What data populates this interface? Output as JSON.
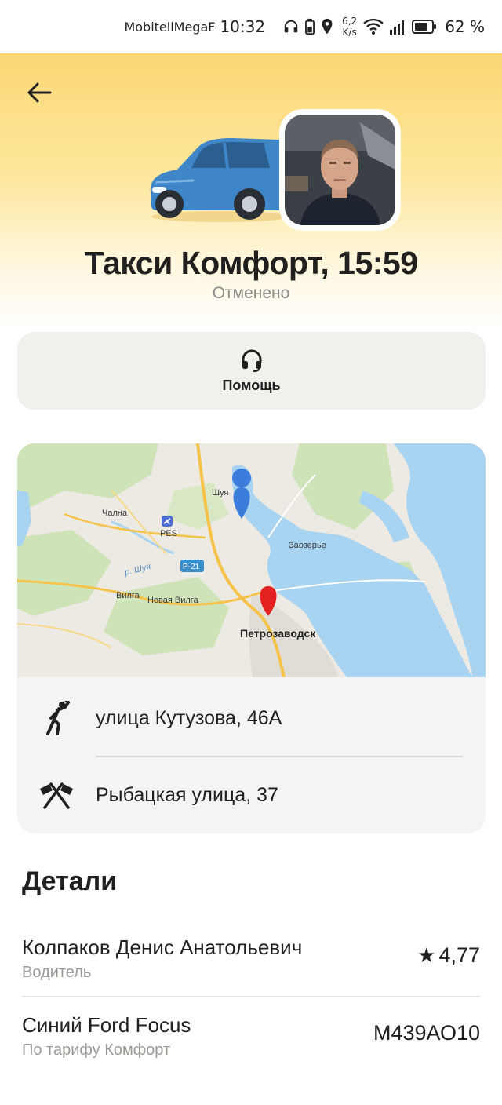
{
  "status_bar": {
    "carrier": "MobitellMegaFon",
    "time": "10:32",
    "speed_value": "6,2",
    "speed_unit": "K/s",
    "battery": "62 %"
  },
  "header": {
    "title": "Такси Комфорт, 15:59",
    "status": "Отменено"
  },
  "help": {
    "label": "Помощь"
  },
  "map": {
    "labels": {
      "shuya": "Шуя",
      "chalna": "Чална",
      "pes": "PES",
      "zaozerye": "Заозерье",
      "shuya_river": "р. Шуя",
      "road": "Р-21",
      "vilga": "Вилга",
      "novaya_vilga": "Новая Вилга",
      "petrozavodsk": "Петрозаводск"
    },
    "colors": {
      "water": "#a8d4f2",
      "land": "#eceae2",
      "forest": "#cfe3b8",
      "road": "#f5c24a",
      "start_pin": "#3c7ddb",
      "end_pin": "#e32121"
    }
  },
  "route": {
    "start": "улица Кутузова, 46А",
    "end": "Рыбацкая улица, 37"
  },
  "details": {
    "title": "Детали",
    "driver_name": "Колпаков Денис Анатольевич",
    "driver_role": "Водитель",
    "rating_star": "★",
    "rating": "4,77",
    "car": "Синий Ford Focus",
    "tariff": "По тарифу Комфорт",
    "plate": "М439АО10"
  },
  "colors": {
    "header_yellow": "#fbd774",
    "card_bg": "#f1f0ed",
    "text": "#21201f",
    "muted": "#8c8b87",
    "car_blue": "#3f86c8"
  }
}
